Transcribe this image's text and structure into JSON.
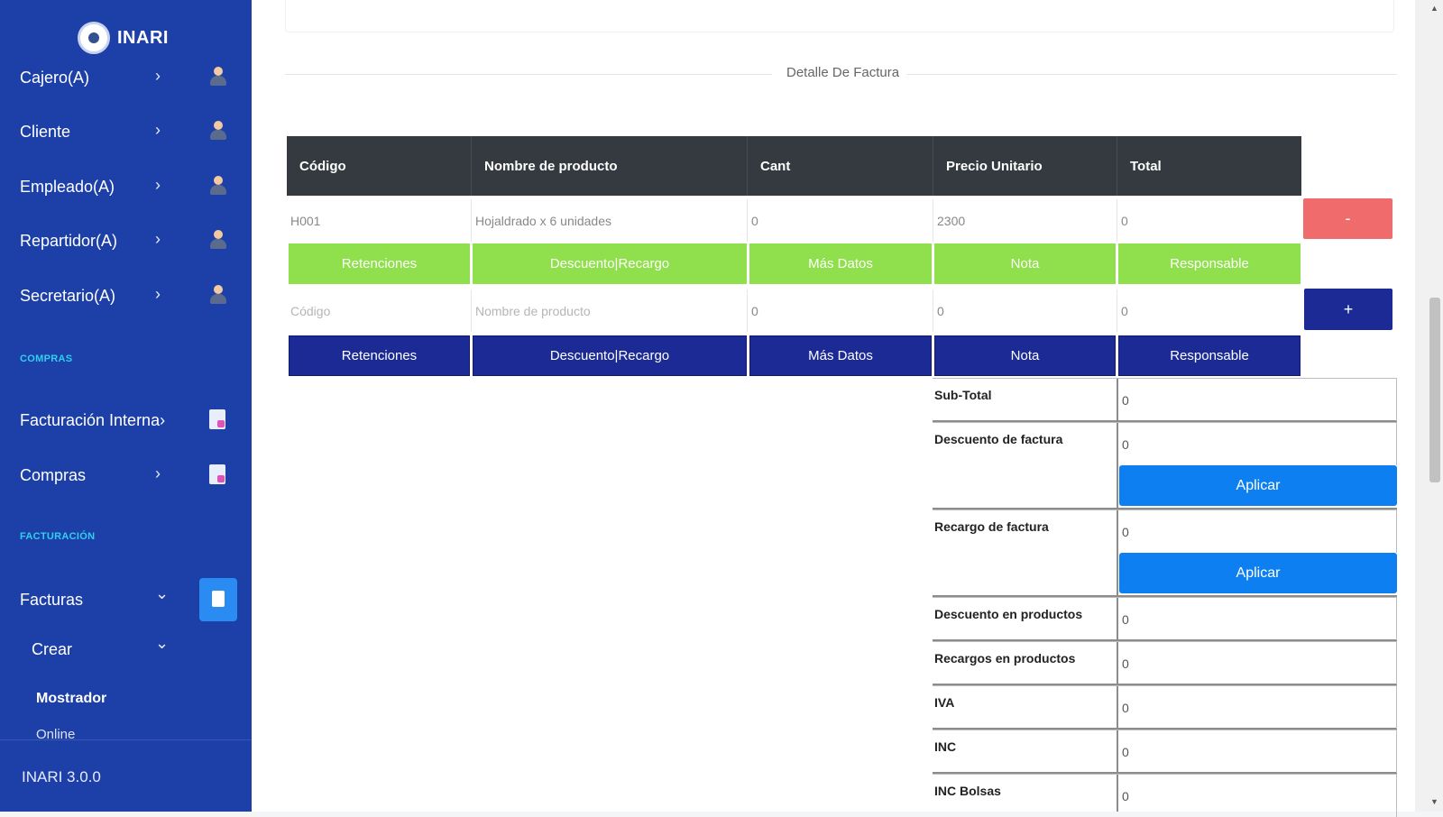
{
  "brand": {
    "name": "INARI"
  },
  "sidebar": {
    "items": [
      {
        "label": "Cajero(A)",
        "chevron": "›",
        "icon": "cashier-icon"
      },
      {
        "label": "Cliente",
        "chevron": "›",
        "icon": "client-icon"
      },
      {
        "label": "Empleado(A)",
        "chevron": "›",
        "icon": "employee-icon"
      },
      {
        "label": "Repartidor(A)",
        "chevron": "›",
        "icon": "delivery-icon"
      },
      {
        "label": "Secretario(A)",
        "chevron": "›",
        "icon": "secretary-icon"
      }
    ],
    "section_compras": "COMPRAS",
    "compras_items": [
      {
        "label": "Facturación Interna›",
        "icon": "internal-invoice-icon"
      },
      {
        "label": "Compras",
        "chevron": "›",
        "icon": "purchases-icon"
      }
    ],
    "section_facturacion": "FACTURACIÓN",
    "facturas": {
      "label": "Facturas",
      "chevron": "⌄",
      "icon": "invoice-icon"
    },
    "crear": {
      "label": "Crear",
      "chevron": "⌄"
    },
    "sub_items": [
      {
        "label": "Mostrador"
      },
      {
        "label": "Online"
      }
    ],
    "version": "INARI 3.0.0"
  },
  "main": {
    "section_caption": "Detalle De Factura",
    "table": {
      "headers": [
        "Código",
        "Nombre de producto",
        "Cant",
        "Precio Unitario",
        "Total"
      ],
      "row1": {
        "code": "H001",
        "name": "Hojaldrado x 6 unidades",
        "qty": "0",
        "price": "2300",
        "total": "0",
        "remove_label": "-"
      },
      "row1_buttons": [
        "Retenciones",
        "Descuento|Recargo",
        "Más Datos",
        "Nota",
        "Responsable"
      ],
      "new_row": {
        "code_placeholder": "Código",
        "name_placeholder": "Nombre de producto",
        "qty": "0",
        "price": "0",
        "total": "0",
        "add_label": "+"
      },
      "new_row_buttons": [
        "Retenciones",
        "Descuento|Recargo",
        "Más Datos",
        "Nota",
        "Responsable"
      ]
    },
    "totals": {
      "subtotal": {
        "label": "Sub-Total",
        "value": "0"
      },
      "descuento_factura": {
        "label": "Descuento de factura",
        "value": "0",
        "button": "Aplicar"
      },
      "recargo_factura": {
        "label": "Recargo de factura",
        "value": "0",
        "button": "Aplicar"
      },
      "descuento_productos": {
        "label": "Descuento en productos",
        "value": "0"
      },
      "recargos_productos": {
        "label": "Recargos en productos",
        "value": "0"
      },
      "iva": {
        "label": "IVA",
        "value": "0"
      },
      "inc": {
        "label": "INC",
        "value": "0"
      },
      "inc_bolsas": {
        "label": "INC Bolsas",
        "value": "0"
      }
    }
  },
  "colors": {
    "sidebar": "#1d3fa8",
    "accent_cyan": "#2fd0ef",
    "green_button": "#8fe04c",
    "navy_button": "#1c2a96",
    "blue_button": "#0d7ff0",
    "red_button": "#f06b6b",
    "table_header": "#343a40"
  }
}
